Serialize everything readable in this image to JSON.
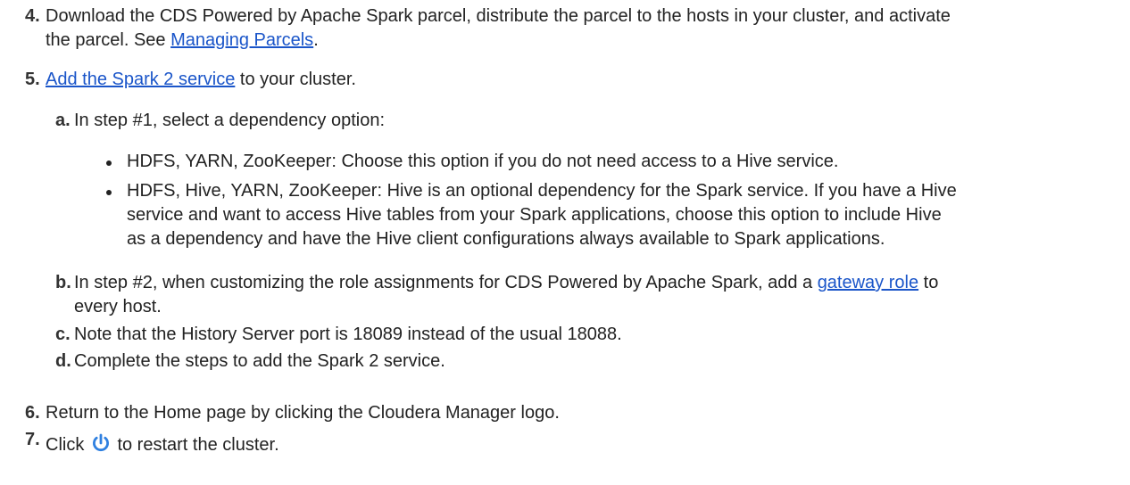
{
  "steps": {
    "s4": {
      "num": "4.",
      "line1": "Download the CDS Powered by Apache Spark parcel, distribute the parcel to the hosts in your cluster, and activate",
      "line2_pre": "the parcel. See ",
      "line2_link": "Managing Parcels",
      "line2_post": "."
    },
    "s5": {
      "num": "5.",
      "link": "Add the Spark 2 service",
      "post": " to your cluster.",
      "sub": {
        "a": {
          "label": "a.",
          "text": "In step #1, select a dependency option:",
          "bullets": [
            {
              "lines": [
                "HDFS, YARN, ZooKeeper: Choose this option if you do not need access to a Hive service."
              ]
            },
            {
              "lines": [
                "HDFS, Hive, YARN, ZooKeeper: Hive is an optional dependency for the Spark service. If you have a Hive",
                "service and want to access Hive tables from your Spark applications, choose this option to include Hive",
                "as a dependency and have the Hive client configurations always available to Spark applications."
              ]
            }
          ]
        },
        "b": {
          "label": "b.",
          "line1_pre": "In step #2, when customizing the role assignments for CDS Powered by Apache Spark, add a ",
          "line1_link": "gateway role",
          "line1_post": " to",
          "line2": "every host."
        },
        "c": {
          "label": "c.",
          "text": "Note that the History Server port is 18089 instead of the usual 18088."
        },
        "d": {
          "label": "d.",
          "text": "Complete the steps to add the Spark 2 service."
        }
      }
    },
    "s6": {
      "num": "6.",
      "text": "Return to the Home page by clicking the Cloudera Manager logo."
    },
    "s7": {
      "num": "7.",
      "pre": "Click ",
      "icon": "power-icon",
      "post": " to restart the cluster."
    }
  },
  "colors": {
    "link": "#1a55c9",
    "icon": "#2f80e0",
    "text": "#222222"
  }
}
